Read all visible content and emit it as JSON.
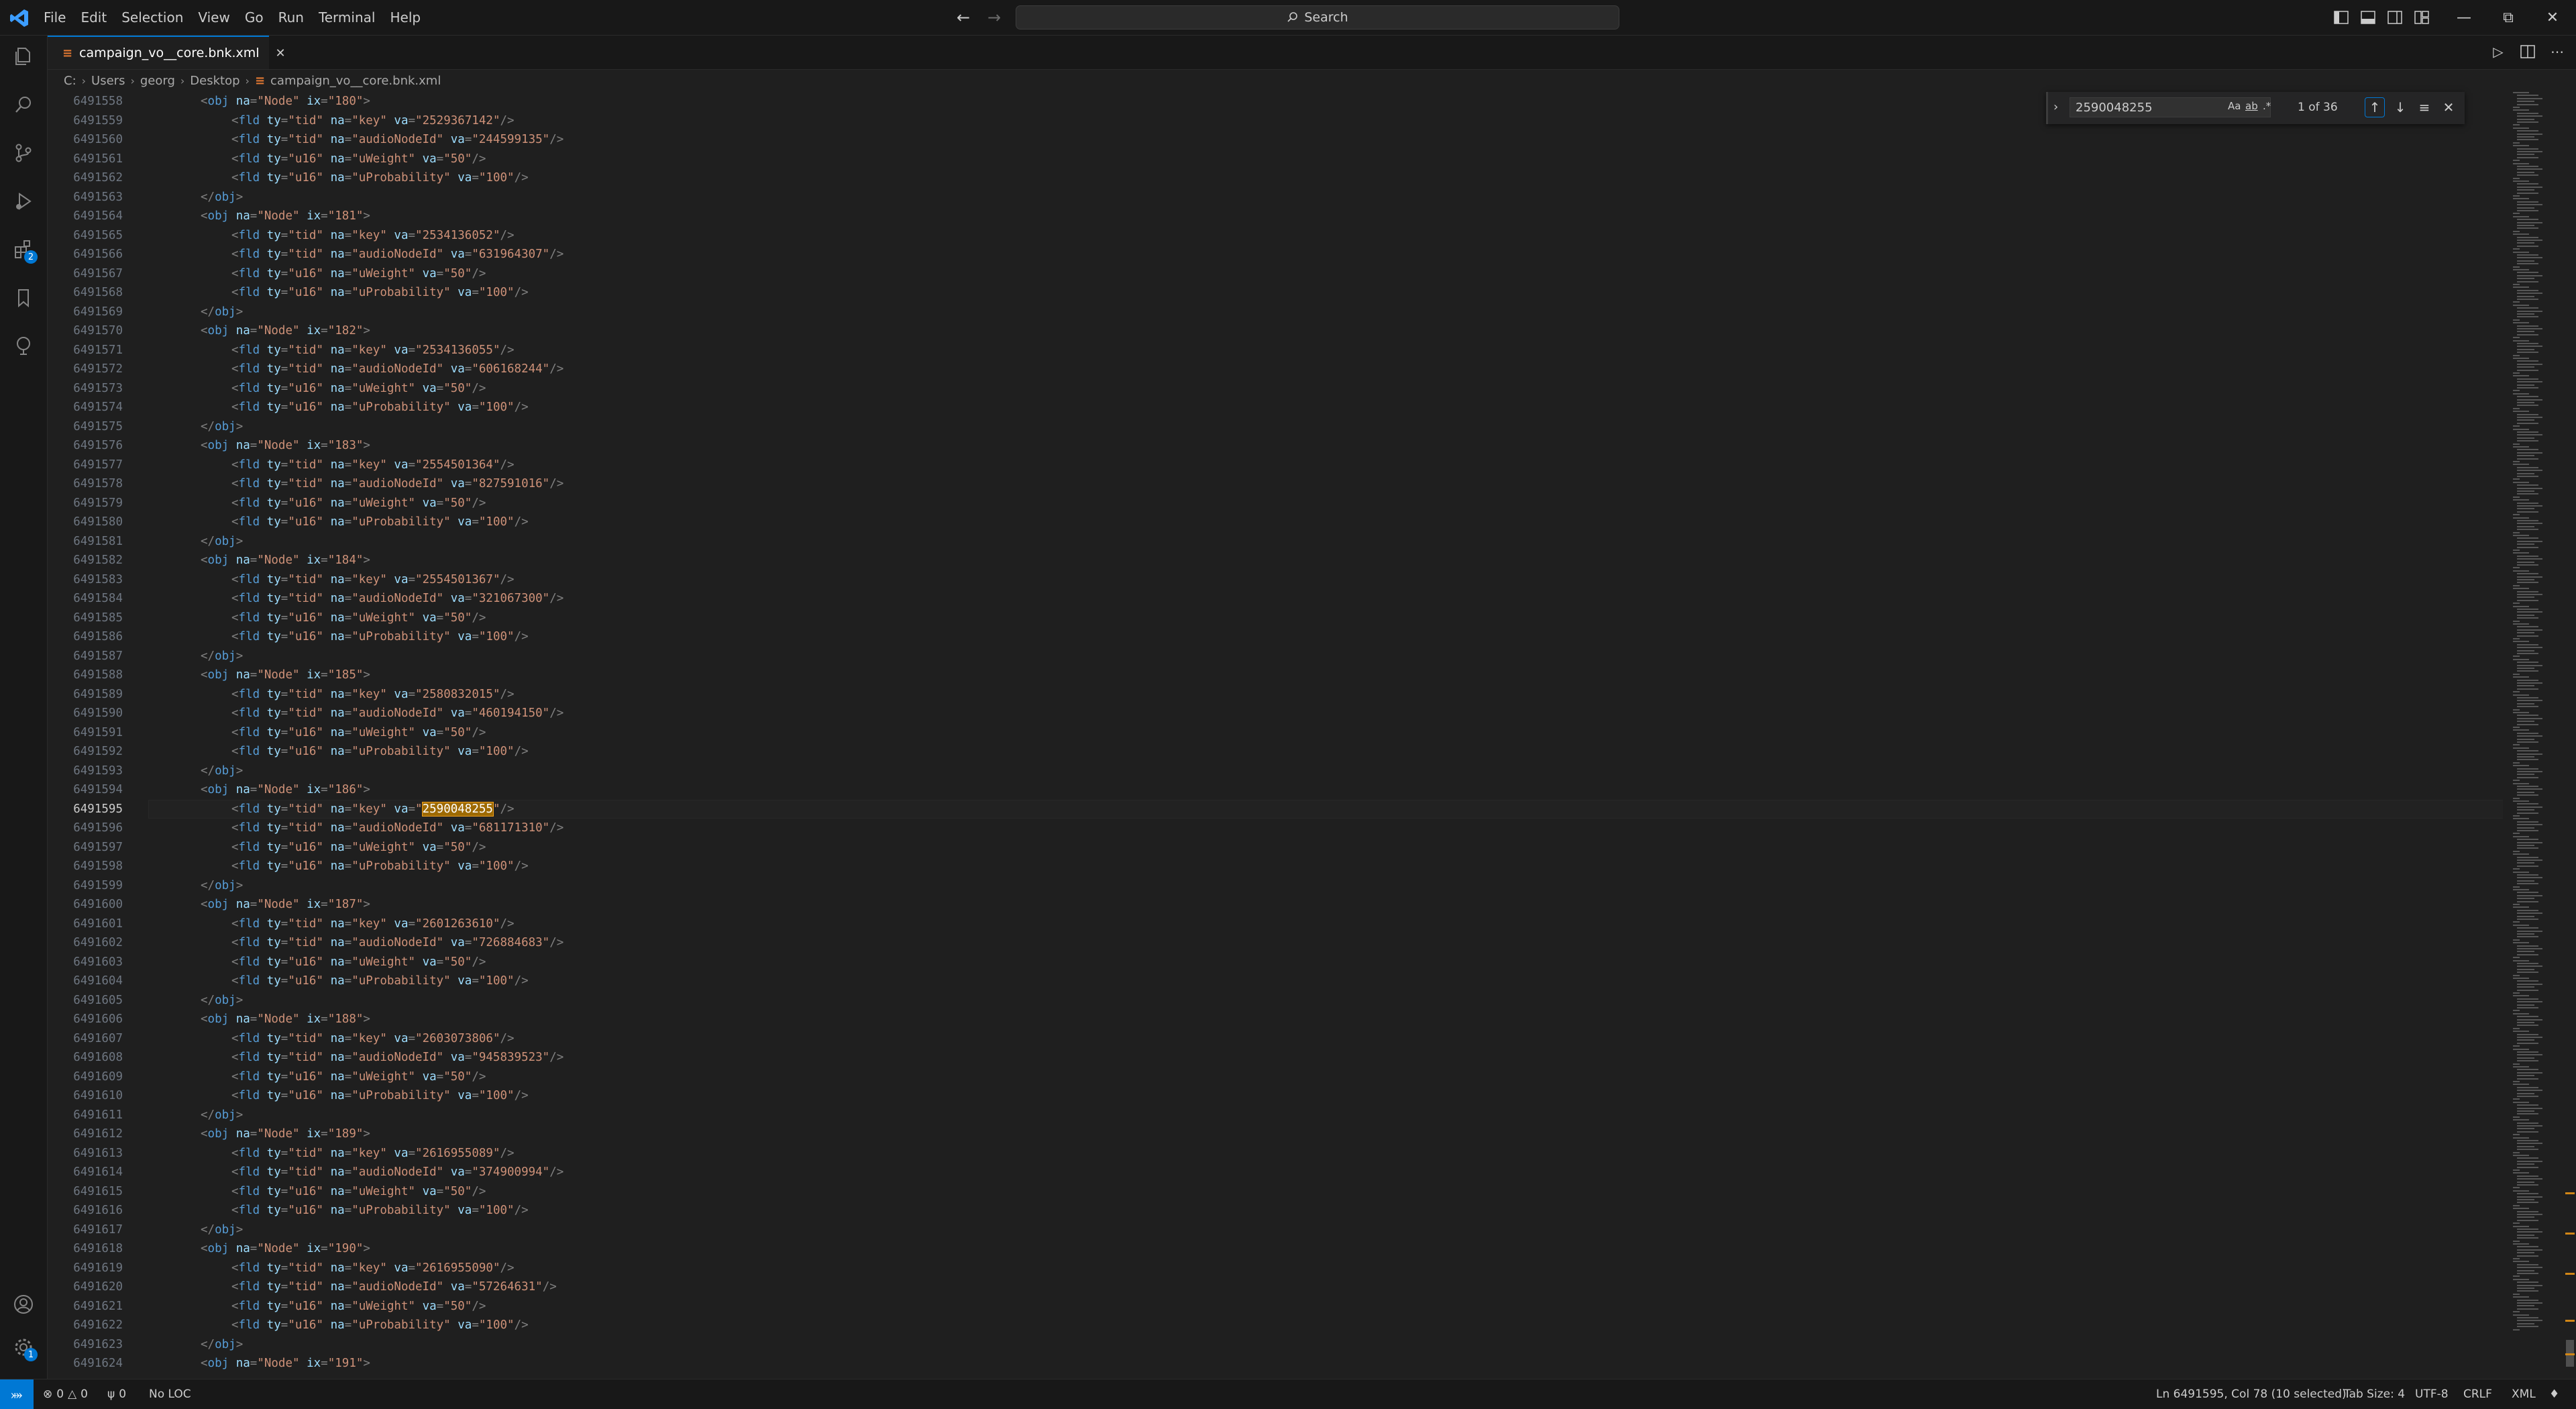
{
  "menu": [
    "File",
    "Edit",
    "Selection",
    "View",
    "Go",
    "Run",
    "Terminal",
    "Help"
  ],
  "command_center": {
    "label": "Search"
  },
  "activity_badges": {
    "extensions": "2",
    "settings": "1"
  },
  "tab": {
    "title": "campaign_vo__core.bnk.xml",
    "icon": "XML-icon"
  },
  "breadcrumb": [
    "C:",
    "Users",
    "georg",
    "Desktop",
    "campaign_vo__core.bnk.xml"
  ],
  "find": {
    "value": "2590048255",
    "match_case": "Aa",
    "whole_word": "ab",
    "regex": ".*",
    "count": "1 of 36"
  },
  "editor": {
    "current_line": "6491595",
    "lines": [
      {
        "n": "6491558",
        "text": "<obj na=\"Node\" ix=\"180\">",
        "indent": 1
      },
      {
        "n": "6491559",
        "text": "<fld ty=\"tid\" na=\"key\" va=\"2529367142\"/>",
        "indent": 2
      },
      {
        "n": "6491560",
        "text": "<fld ty=\"tid\" na=\"audioNodeId\" va=\"244599135\"/>",
        "indent": 2
      },
      {
        "n": "6491561",
        "text": "<fld ty=\"u16\" na=\"uWeight\" va=\"50\"/>",
        "indent": 2
      },
      {
        "n": "6491562",
        "text": "<fld ty=\"u16\" na=\"uProbability\" va=\"100\"/>",
        "indent": 2
      },
      {
        "n": "6491563",
        "text": "</obj>",
        "indent": 1
      },
      {
        "n": "6491564",
        "text": "<obj na=\"Node\" ix=\"181\">",
        "indent": 1
      },
      {
        "n": "6491565",
        "text": "<fld ty=\"tid\" na=\"key\" va=\"2534136052\"/>",
        "indent": 2
      },
      {
        "n": "6491566",
        "text": "<fld ty=\"tid\" na=\"audioNodeId\" va=\"631964307\"/>",
        "indent": 2
      },
      {
        "n": "6491567",
        "text": "<fld ty=\"u16\" na=\"uWeight\" va=\"50\"/>",
        "indent": 2
      },
      {
        "n": "6491568",
        "text": "<fld ty=\"u16\" na=\"uProbability\" va=\"100\"/>",
        "indent": 2
      },
      {
        "n": "6491569",
        "text": "</obj>",
        "indent": 1
      },
      {
        "n": "6491570",
        "text": "<obj na=\"Node\" ix=\"182\">",
        "indent": 1
      },
      {
        "n": "6491571",
        "text": "<fld ty=\"tid\" na=\"key\" va=\"2534136055\"/>",
        "indent": 2
      },
      {
        "n": "6491572",
        "text": "<fld ty=\"tid\" na=\"audioNodeId\" va=\"606168244\"/>",
        "indent": 2
      },
      {
        "n": "6491573",
        "text": "<fld ty=\"u16\" na=\"uWeight\" va=\"50\"/>",
        "indent": 2
      },
      {
        "n": "6491574",
        "text": "<fld ty=\"u16\" na=\"uProbability\" va=\"100\"/>",
        "indent": 2
      },
      {
        "n": "6491575",
        "text": "</obj>",
        "indent": 1
      },
      {
        "n": "6491576",
        "text": "<obj na=\"Node\" ix=\"183\">",
        "indent": 1
      },
      {
        "n": "6491577",
        "text": "<fld ty=\"tid\" na=\"key\" va=\"2554501364\"/>",
        "indent": 2
      },
      {
        "n": "6491578",
        "text": "<fld ty=\"tid\" na=\"audioNodeId\" va=\"827591016\"/>",
        "indent": 2
      },
      {
        "n": "6491579",
        "text": "<fld ty=\"u16\" na=\"uWeight\" va=\"50\"/>",
        "indent": 2
      },
      {
        "n": "6491580",
        "text": "<fld ty=\"u16\" na=\"uProbability\" va=\"100\"/>",
        "indent": 2
      },
      {
        "n": "6491581",
        "text": "</obj>",
        "indent": 1
      },
      {
        "n": "6491582",
        "text": "<obj na=\"Node\" ix=\"184\">",
        "indent": 1
      },
      {
        "n": "6491583",
        "text": "<fld ty=\"tid\" na=\"key\" va=\"2554501367\"/>",
        "indent": 2
      },
      {
        "n": "6491584",
        "text": "<fld ty=\"tid\" na=\"audioNodeId\" va=\"321067300\"/>",
        "indent": 2
      },
      {
        "n": "6491585",
        "text": "<fld ty=\"u16\" na=\"uWeight\" va=\"50\"/>",
        "indent": 2
      },
      {
        "n": "6491586",
        "text": "<fld ty=\"u16\" na=\"uProbability\" va=\"100\"/>",
        "indent": 2
      },
      {
        "n": "6491587",
        "text": "</obj>",
        "indent": 1
      },
      {
        "n": "6491588",
        "text": "<obj na=\"Node\" ix=\"185\">",
        "indent": 1
      },
      {
        "n": "6491589",
        "text": "<fld ty=\"tid\" na=\"key\" va=\"2580832015\"/>",
        "indent": 2
      },
      {
        "n": "6491590",
        "text": "<fld ty=\"tid\" na=\"audioNodeId\" va=\"460194150\"/>",
        "indent": 2
      },
      {
        "n": "6491591",
        "text": "<fld ty=\"u16\" na=\"uWeight\" va=\"50\"/>",
        "indent": 2
      },
      {
        "n": "6491592",
        "text": "<fld ty=\"u16\" na=\"uProbability\" va=\"100\"/>",
        "indent": 2
      },
      {
        "n": "6491593",
        "text": "</obj>",
        "indent": 1
      },
      {
        "n": "6491594",
        "text": "<obj na=\"Node\" ix=\"186\">",
        "indent": 1
      },
      {
        "n": "6491595",
        "text": "<fld ty=\"tid\" na=\"key\" va=\"2590048255\"/>",
        "indent": 2
      },
      {
        "n": "6491596",
        "text": "<fld ty=\"tid\" na=\"audioNodeId\" va=\"681171310\"/>",
        "indent": 2
      },
      {
        "n": "6491597",
        "text": "<fld ty=\"u16\" na=\"uWeight\" va=\"50\"/>",
        "indent": 2
      },
      {
        "n": "6491598",
        "text": "<fld ty=\"u16\" na=\"uProbability\" va=\"100\"/>",
        "indent": 2
      },
      {
        "n": "6491599",
        "text": "</obj>",
        "indent": 1
      },
      {
        "n": "6491600",
        "text": "<obj na=\"Node\" ix=\"187\">",
        "indent": 1
      },
      {
        "n": "6491601",
        "text": "<fld ty=\"tid\" na=\"key\" va=\"2601263610\"/>",
        "indent": 2
      },
      {
        "n": "6491602",
        "text": "<fld ty=\"tid\" na=\"audioNodeId\" va=\"726884683\"/>",
        "indent": 2
      },
      {
        "n": "6491603",
        "text": "<fld ty=\"u16\" na=\"uWeight\" va=\"50\"/>",
        "indent": 2
      },
      {
        "n": "6491604",
        "text": "<fld ty=\"u16\" na=\"uProbability\" va=\"100\"/>",
        "indent": 2
      },
      {
        "n": "6491605",
        "text": "</obj>",
        "indent": 1
      },
      {
        "n": "6491606",
        "text": "<obj na=\"Node\" ix=\"188\">",
        "indent": 1
      },
      {
        "n": "6491607",
        "text": "<fld ty=\"tid\" na=\"key\" va=\"2603073806\"/>",
        "indent": 2
      },
      {
        "n": "6491608",
        "text": "<fld ty=\"tid\" na=\"audioNodeId\" va=\"945839523\"/>",
        "indent": 2
      },
      {
        "n": "6491609",
        "text": "<fld ty=\"u16\" na=\"uWeight\" va=\"50\"/>",
        "indent": 2
      },
      {
        "n": "6491610",
        "text": "<fld ty=\"u16\" na=\"uProbability\" va=\"100\"/>",
        "indent": 2
      },
      {
        "n": "6491611",
        "text": "</obj>",
        "indent": 1
      },
      {
        "n": "6491612",
        "text": "<obj na=\"Node\" ix=\"189\">",
        "indent": 1
      },
      {
        "n": "6491613",
        "text": "<fld ty=\"tid\" na=\"key\" va=\"2616955089\"/>",
        "indent": 2
      },
      {
        "n": "6491614",
        "text": "<fld ty=\"tid\" na=\"audioNodeId\" va=\"374900994\"/>",
        "indent": 2
      },
      {
        "n": "6491615",
        "text": "<fld ty=\"u16\" na=\"uWeight\" va=\"50\"/>",
        "indent": 2
      },
      {
        "n": "6491616",
        "text": "<fld ty=\"u16\" na=\"uProbability\" va=\"100\"/>",
        "indent": 2
      },
      {
        "n": "6491617",
        "text": "</obj>",
        "indent": 1
      },
      {
        "n": "6491618",
        "text": "<obj na=\"Node\" ix=\"190\">",
        "indent": 1
      },
      {
        "n": "6491619",
        "text": "<fld ty=\"tid\" na=\"key\" va=\"2616955090\"/>",
        "indent": 2
      },
      {
        "n": "6491620",
        "text": "<fld ty=\"tid\" na=\"audioNodeId\" va=\"57264631\"/>",
        "indent": 2
      },
      {
        "n": "6491621",
        "text": "<fld ty=\"u16\" na=\"uWeight\" va=\"50\"/>",
        "indent": 2
      },
      {
        "n": "6491622",
        "text": "<fld ty=\"u16\" na=\"uProbability\" va=\"100\"/>",
        "indent": 2
      },
      {
        "n": "6491623",
        "text": "</obj>",
        "indent": 1
      },
      {
        "n": "6491624",
        "text": "<obj na=\"Node\" ix=\"191\">",
        "indent": 1
      }
    ]
  },
  "statusbar": {
    "errors": "0",
    "warnings": "0",
    "ports": "0",
    "loc": "No LOC",
    "position": "Ln 6491595, Col 78 (10 selected)",
    "tab_size": "Tab Size: 4",
    "encoding": "UTF-8",
    "eol": "CRLF",
    "language": "XML"
  },
  "colors": {
    "accent": "#0078d4",
    "match_highlight": "#9e6a03",
    "xml_icon": "#e37933"
  }
}
